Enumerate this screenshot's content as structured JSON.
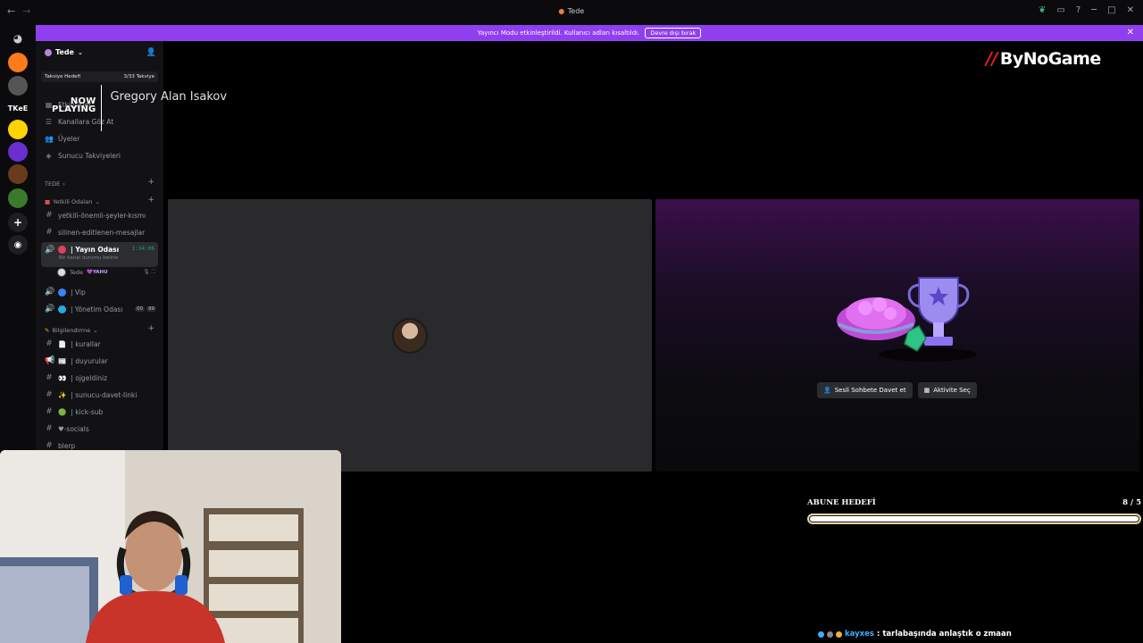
{
  "window": {
    "title": "Tede",
    "back": "←",
    "forward": "→"
  },
  "banner": {
    "message": "Yayıncı Modu etkinleştirildi. Kullanıcı adları kısaltıldı.",
    "button": "Devre dışı bırak",
    "close": "✕"
  },
  "rail": {
    "servers": [
      {
        "label": "",
        "color": "#ff7a1a"
      },
      {
        "label": "",
        "color": "#555"
      },
      {
        "label": "TKeE",
        "color": "#0b0b0d"
      },
      {
        "label": "",
        "color": "#ffd400"
      },
      {
        "label": "",
        "color": "#6b2fd0"
      },
      {
        "label": "",
        "color": "#6a3a1a"
      },
      {
        "label": "",
        "color": "#3a7a2a"
      }
    ]
  },
  "sidebar": {
    "server_name": "Tede",
    "boost": {
      "label": "Takviye Hedefi",
      "progress": "3/33 Takviye"
    },
    "items": [
      {
        "label": "Etkinlikler"
      },
      {
        "label": "Kanallara Göz At"
      },
      {
        "label": "Üyeler"
      },
      {
        "label": "Sunucu Takviyeleri"
      }
    ],
    "category_tede": "TEDE",
    "category_staff": "Yetkili Odaları",
    "channels_staff": [
      {
        "name": "yetkili-önemli-şeyler-kısmı"
      },
      {
        "name": "silinen-editlenen-mesajlar"
      }
    ],
    "live_channel": {
      "name": "| Yayın Odası",
      "timer": "1:34:06",
      "status": "Bir kanal durumu belirle",
      "user": "Tede",
      "user_tag": "💜YAHU"
    },
    "channels_voice": [
      {
        "name": "| Vip",
        "color": "#3b82f6"
      },
      {
        "name": "| Yönetim Odası",
        "color": "#2aa9e0",
        "badge1": "00",
        "badge2": "99"
      }
    ],
    "category_info": "Bilgilendirme",
    "channels_info": [
      {
        "name": "| kurallar",
        "icon": "#",
        "emoji": "📄"
      },
      {
        "name": "| duyurular",
        "icon": "📢",
        "emoji": "📰"
      },
      {
        "name": "| ojgeldiniz",
        "icon": "#",
        "emoji": "👀"
      },
      {
        "name": "| sunucu-davet-linki",
        "icon": "#",
        "emoji": "✨"
      },
      {
        "name": "| kick-sub",
        "icon": "#",
        "emoji": "🟢"
      },
      {
        "name": "♥-socials",
        "icon": "#",
        "emoji": ""
      },
      {
        "name": "blerp",
        "icon": "#",
        "emoji": ""
      }
    ]
  },
  "now_playing": {
    "label_line1": "NOW",
    "label_line2": "PLAYING",
    "song": "Gregory Alan Isakov"
  },
  "activity": {
    "invite_button": "Sesli Sohbete Davet et",
    "activity_button": "Aktivite Seç"
  },
  "logo": {
    "text": "ByNoGame",
    "color": "#e2231a"
  },
  "sub_goal": {
    "title": "ABUNE HEDEFİ",
    "count": "8 / 5",
    "progress": 1.0
  },
  "chat": {
    "user": "kayxes",
    "message": ": tarlabaşında anlaştık o zmaan"
  }
}
